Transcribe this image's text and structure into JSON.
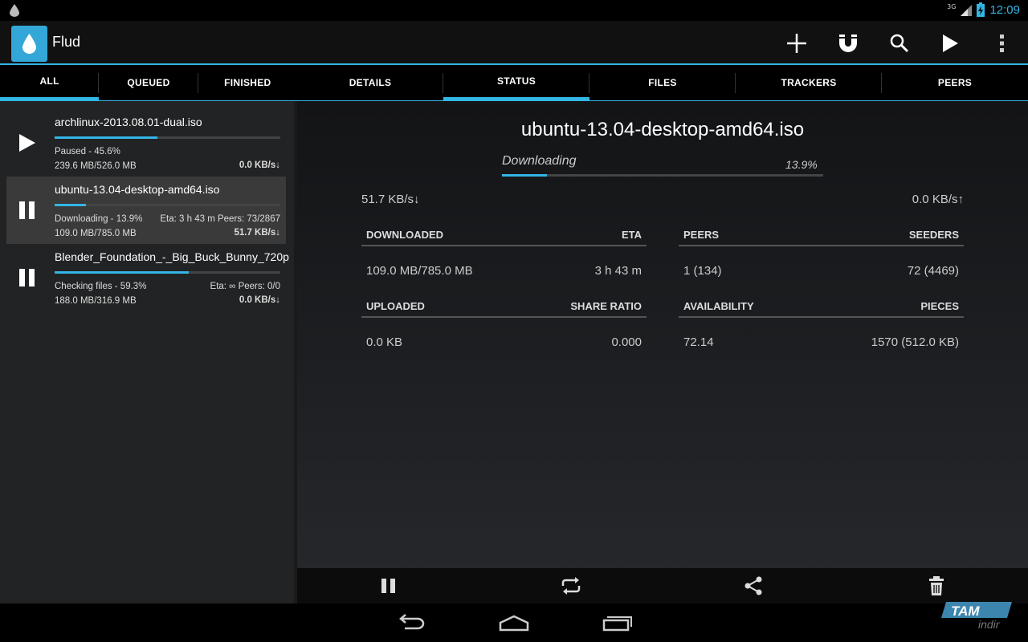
{
  "status_bar": {
    "signal": "3G",
    "time": "12:09"
  },
  "app": {
    "title": "Flud"
  },
  "action_bar": {
    "icons": [
      "add-icon",
      "magnet-icon",
      "search-icon",
      "play-icon",
      "overflow-menu-icon"
    ]
  },
  "list_tabs": [
    {
      "label": "ALL",
      "active": true
    },
    {
      "label": "QUEUED",
      "active": false
    },
    {
      "label": "FINISHED",
      "active": false
    }
  ],
  "detail_tabs": [
    {
      "label": "DETAILS",
      "active": false
    },
    {
      "label": "STATUS",
      "active": true
    },
    {
      "label": "FILES",
      "active": false
    },
    {
      "label": "TRACKERS",
      "active": false
    },
    {
      "label": "PEERS",
      "active": false
    }
  ],
  "torrents": [
    {
      "name": "archlinux-2013.08.01-dual.iso",
      "progress": 0.456,
      "status": "Paused - 45.6%",
      "extra": "",
      "size": "239.6 MB/526.0 MB",
      "speed": "0.0 KB/s↓",
      "action_icon": "play-icon",
      "selected": false
    },
    {
      "name": "ubuntu-13.04-desktop-amd64.iso",
      "progress": 0.139,
      "status": "Downloading - 13.9%",
      "extra": "Eta: 3 h 43 m  Peers: 73/2867",
      "size": "109.0 MB/785.0 MB",
      "speed": "51.7 KB/s↓",
      "action_icon": "pause-icon",
      "selected": true
    },
    {
      "name": "Blender_Foundation_-_Big_Buck_Bunny_720p",
      "progress": 0.593,
      "status": "Checking files - 59.3%",
      "extra": "Eta: ∞  Peers: 0/0",
      "size": "188.0 MB/316.9 MB",
      "speed": "0.0 KB/s↓",
      "action_icon": "pause-icon",
      "selected": false
    }
  ],
  "detail": {
    "title": "ubuntu-13.04-desktop-amd64.iso",
    "state": "Downloading",
    "percent_label": "13.9%",
    "progress": 0.139,
    "download_speed": "51.7 KB/s↓",
    "upload_speed": "0.0 KB/s↑",
    "downloaded_label": "DOWNLOADED",
    "downloaded_value": "109.0 MB/785.0 MB",
    "eta_label": "ETA",
    "eta_value": "3 h 43 m",
    "peers_label": "PEERS",
    "peers_value": "1 (134)",
    "seeders_label": "SEEDERS",
    "seeders_value": "72 (4469)",
    "uploaded_label": "UPLOADED",
    "uploaded_value": "0.0 KB",
    "share_ratio_label": "SHARE RATIO",
    "share_ratio_value": "0.000",
    "availability_label": "AVAILABILITY",
    "availability_value": "72.14",
    "pieces_label": "PIECES",
    "pieces_value": "1570 (512.0 KB)"
  },
  "bottom_actions": [
    "pause-icon",
    "repeat-icon",
    "share-icon",
    "delete-icon"
  ],
  "nav": [
    "back-icon",
    "home-icon",
    "recents-icon"
  ],
  "watermark": {
    "line1": "TAM",
    "line2": "indir"
  },
  "colors": {
    "accent": "#33b5e5",
    "background": "#000000",
    "panel": "#222324"
  }
}
